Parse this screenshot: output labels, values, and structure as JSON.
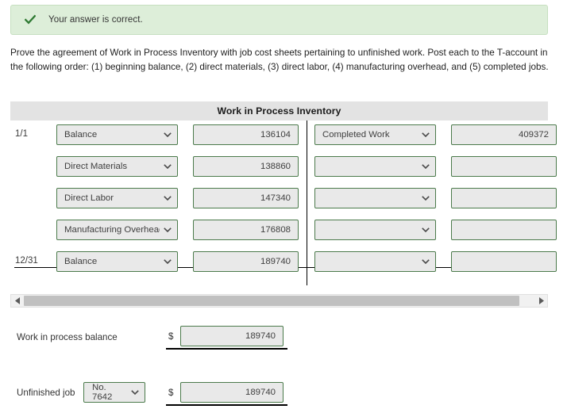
{
  "banner": {
    "icon": "check-icon",
    "message": "Your answer is correct.",
    "background_color": "#ddeed9",
    "border_color": "#c6dfc0",
    "icon_color": "#2f7a33"
  },
  "prompt": {
    "text": "Prove the agreement of Work in Process Inventory with job cost sheets pertaining to unfinished work. Post each to the T-account in the following order: (1) beginning balance, (2) direct materials, (3) direct labor, (4) manufacturing overhead, and (5) completed jobs."
  },
  "taccount": {
    "title": "Work in Process Inventory",
    "header_background": "#e3e3e3",
    "field_border_color": "#4b7a4b",
    "field_background": "#e9e9e9",
    "rows": [
      {
        "date": "1/1",
        "debit_account": "Balance",
        "debit_amount": "136104",
        "credit_account": "Completed Work",
        "credit_amount": "409372"
      },
      {
        "date": "",
        "debit_account": "Direct Materials",
        "debit_amount": "138860",
        "credit_account": "",
        "credit_amount": ""
      },
      {
        "date": "",
        "debit_account": "Direct Labor",
        "debit_amount": "147340",
        "credit_account": "",
        "credit_amount": ""
      },
      {
        "date": "",
        "debit_account": "Manufacturing Overhead",
        "debit_amount": "176808",
        "credit_account": "",
        "credit_amount": ""
      },
      {
        "date": "12/31",
        "debit_account": "Balance",
        "debit_amount": "189740",
        "credit_account": "",
        "credit_amount": ""
      }
    ]
  },
  "scrollbar": {
    "left_arrow": "triangle-left-icon",
    "right_arrow": "triangle-right-icon"
  },
  "answers": {
    "balance_row": {
      "label": "Work in process balance",
      "currency_symbol": "$",
      "value": "189740"
    },
    "unfinished_row": {
      "label": "Unfinished job",
      "job_number": "No. 7642",
      "currency_symbol": "$",
      "value": "189740"
    }
  }
}
